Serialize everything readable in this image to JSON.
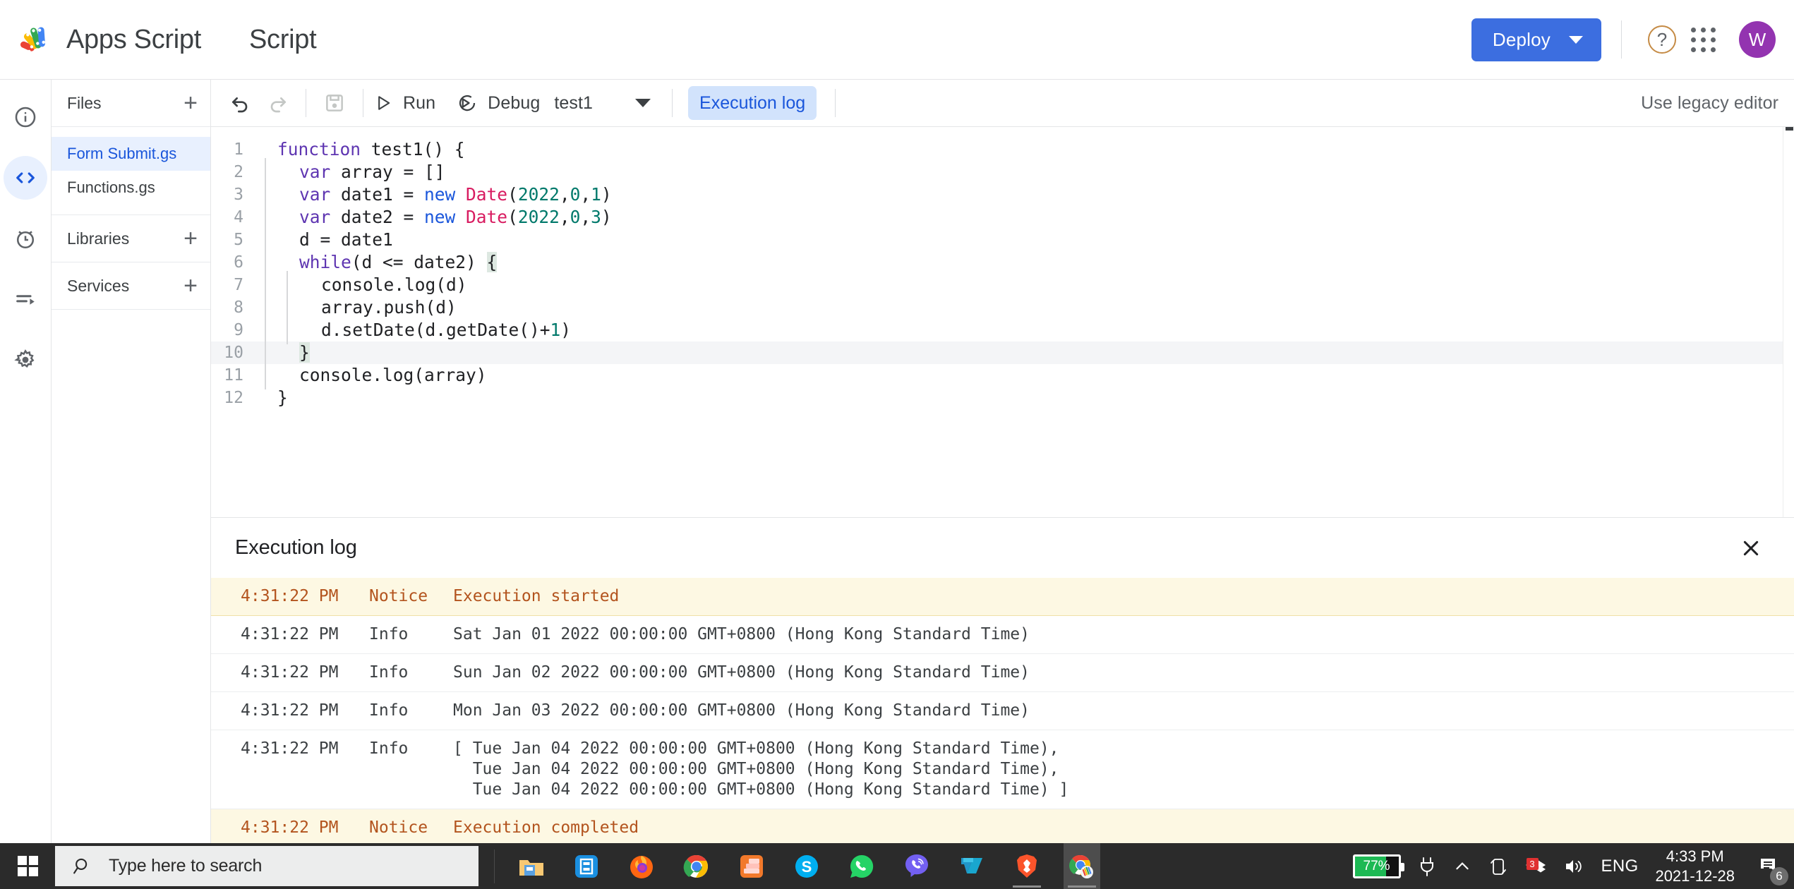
{
  "topbar": {
    "product_name": "Apps Script",
    "doc_title": "Script",
    "deploy_label": "Deploy",
    "help_glyph": "?",
    "avatar_initial": "W",
    "deploy_color": "#3c6ee0",
    "avatar_color": "#9334b0"
  },
  "rail": {
    "items": [
      {
        "name": "overview-icon",
        "title": "Overview"
      },
      {
        "name": "editor-icon",
        "title": "Editor",
        "active": true
      },
      {
        "name": "triggers-icon",
        "title": "Triggers"
      },
      {
        "name": "executions-icon",
        "title": "Executions"
      },
      {
        "name": "settings-icon",
        "title": "Project Settings"
      }
    ]
  },
  "files_panel": {
    "files_header": "Files",
    "libraries_header": "Libraries",
    "services_header": "Services",
    "add_glyph": "+",
    "files": [
      {
        "name": "Form Submit.gs",
        "selected": true
      },
      {
        "name": "Functions.gs",
        "selected": false
      }
    ]
  },
  "editor_toolbar": {
    "undo_label": "Undo",
    "redo_label": "Redo",
    "save_label": "Save project",
    "run_label": "Run",
    "debug_label": "Debug",
    "function_selected": "test1",
    "execution_log_label": "Execution log",
    "legacy_editor_label": "Use legacy editor"
  },
  "code": {
    "lines": [
      {
        "n": "1",
        "tokens": [
          {
            "t": "function ",
            "c": "kw"
          },
          {
            "t": "test1() {",
            "c": "pln"
          }
        ],
        "indent": 0,
        "highlight": false
      },
      {
        "n": "2",
        "tokens": [
          {
            "t": "var",
            "c": "kw"
          },
          {
            "t": " array = []",
            "c": "pln"
          }
        ],
        "indent": 1,
        "highlight": false
      },
      {
        "n": "3",
        "tokens": [
          {
            "t": "var",
            "c": "kw"
          },
          {
            "t": " date1 = ",
            "c": "pln"
          },
          {
            "t": "new ",
            "c": "kw2"
          },
          {
            "t": "Date",
            "c": "cls"
          },
          {
            "t": "(",
            "c": "pln"
          },
          {
            "t": "2022",
            "c": "num"
          },
          {
            "t": ",",
            "c": "pln"
          },
          {
            "t": "0",
            "c": "num"
          },
          {
            "t": ",",
            "c": "pln"
          },
          {
            "t": "1",
            "c": "num"
          },
          {
            "t": ")",
            "c": "pln"
          }
        ],
        "indent": 1,
        "highlight": false
      },
      {
        "n": "4",
        "tokens": [
          {
            "t": "var",
            "c": "kw"
          },
          {
            "t": " date2 = ",
            "c": "pln"
          },
          {
            "t": "new ",
            "c": "kw2"
          },
          {
            "t": "Date",
            "c": "cls"
          },
          {
            "t": "(",
            "c": "pln"
          },
          {
            "t": "2022",
            "c": "num"
          },
          {
            "t": ",",
            "c": "pln"
          },
          {
            "t": "0",
            "c": "num"
          },
          {
            "t": ",",
            "c": "pln"
          },
          {
            "t": "3",
            "c": "num"
          },
          {
            "t": ")",
            "c": "pln"
          }
        ],
        "indent": 1,
        "highlight": false
      },
      {
        "n": "5",
        "tokens": [
          {
            "t": "d = date1",
            "c": "pln"
          }
        ],
        "indent": 1,
        "highlight": false
      },
      {
        "n": "6",
        "tokens": [
          {
            "t": "while",
            "c": "kw"
          },
          {
            "t": "(d <= date2) ",
            "c": "pln"
          },
          {
            "t": "{",
            "c": "pln bmatch"
          }
        ],
        "indent": 1,
        "highlight": false
      },
      {
        "n": "7",
        "tokens": [
          {
            "t": "console.log(d)",
            "c": "pln"
          }
        ],
        "indent": 2,
        "highlight": false
      },
      {
        "n": "8",
        "tokens": [
          {
            "t": "array.push(d)",
            "c": "pln"
          }
        ],
        "indent": 2,
        "highlight": false
      },
      {
        "n": "9",
        "tokens": [
          {
            "t": "d.setDate(d.getDate()+",
            "c": "pln"
          },
          {
            "t": "1",
            "c": "num"
          },
          {
            "t": ")",
            "c": "pln"
          }
        ],
        "indent": 2,
        "highlight": false
      },
      {
        "n": "10",
        "tokens": [
          {
            "t": "}",
            "c": "pln bmatch"
          }
        ],
        "indent": 1,
        "highlight": true
      },
      {
        "n": "11",
        "tokens": [
          {
            "t": "console.log(array)",
            "c": "pln"
          }
        ],
        "indent": 1,
        "highlight": false
      },
      {
        "n": "12",
        "tokens": [
          {
            "t": "}",
            "c": "pln"
          }
        ],
        "indent": 0,
        "highlight": false
      }
    ]
  },
  "execution_log": {
    "title": "Execution log",
    "close_label": "Close",
    "rows": [
      {
        "time": "4:31:22 PM",
        "severity": "Notice",
        "message": "Execution started",
        "kind": "notice"
      },
      {
        "time": "4:31:22 PM",
        "severity": "Info",
        "message": "Sat Jan 01 2022 00:00:00 GMT+0800 (Hong Kong Standard Time)",
        "kind": "info"
      },
      {
        "time": "4:31:22 PM",
        "severity": "Info",
        "message": "Sun Jan 02 2022 00:00:00 GMT+0800 (Hong Kong Standard Time)",
        "kind": "info"
      },
      {
        "time": "4:31:22 PM",
        "severity": "Info",
        "message": "Mon Jan 03 2022 00:00:00 GMT+0800 (Hong Kong Standard Time)",
        "kind": "info"
      },
      {
        "time": "4:31:22 PM",
        "severity": "Info",
        "message": "[ Tue Jan 04 2022 00:00:00 GMT+0800 (Hong Kong Standard Time),\n  Tue Jan 04 2022 00:00:00 GMT+0800 (Hong Kong Standard Time),\n  Tue Jan 04 2022 00:00:00 GMT+0800 (Hong Kong Standard Time) ]",
        "kind": "info"
      },
      {
        "time": "4:31:22 PM",
        "severity": "Notice",
        "message": "Execution completed",
        "kind": "notice"
      }
    ]
  },
  "taskbar": {
    "search_placeholder": "Type here to search",
    "apps": [
      {
        "name": "file-explorer-icon"
      },
      {
        "name": "blue-book-app-icon"
      },
      {
        "name": "firefox-icon"
      },
      {
        "name": "chrome-icon"
      },
      {
        "name": "orange-stack-app-icon"
      },
      {
        "name": "skype-icon"
      },
      {
        "name": "whatsapp-icon"
      },
      {
        "name": "viber-icon"
      },
      {
        "name": "tradingview-icon"
      },
      {
        "name": "brave-icon"
      },
      {
        "name": "chrome-apps-script-icon"
      }
    ],
    "battery_percent": "77%",
    "language": "ENG",
    "time": "4:33 PM",
    "date": "2021-12-28",
    "notification_count": "6",
    "dropbox_badge": "3"
  }
}
